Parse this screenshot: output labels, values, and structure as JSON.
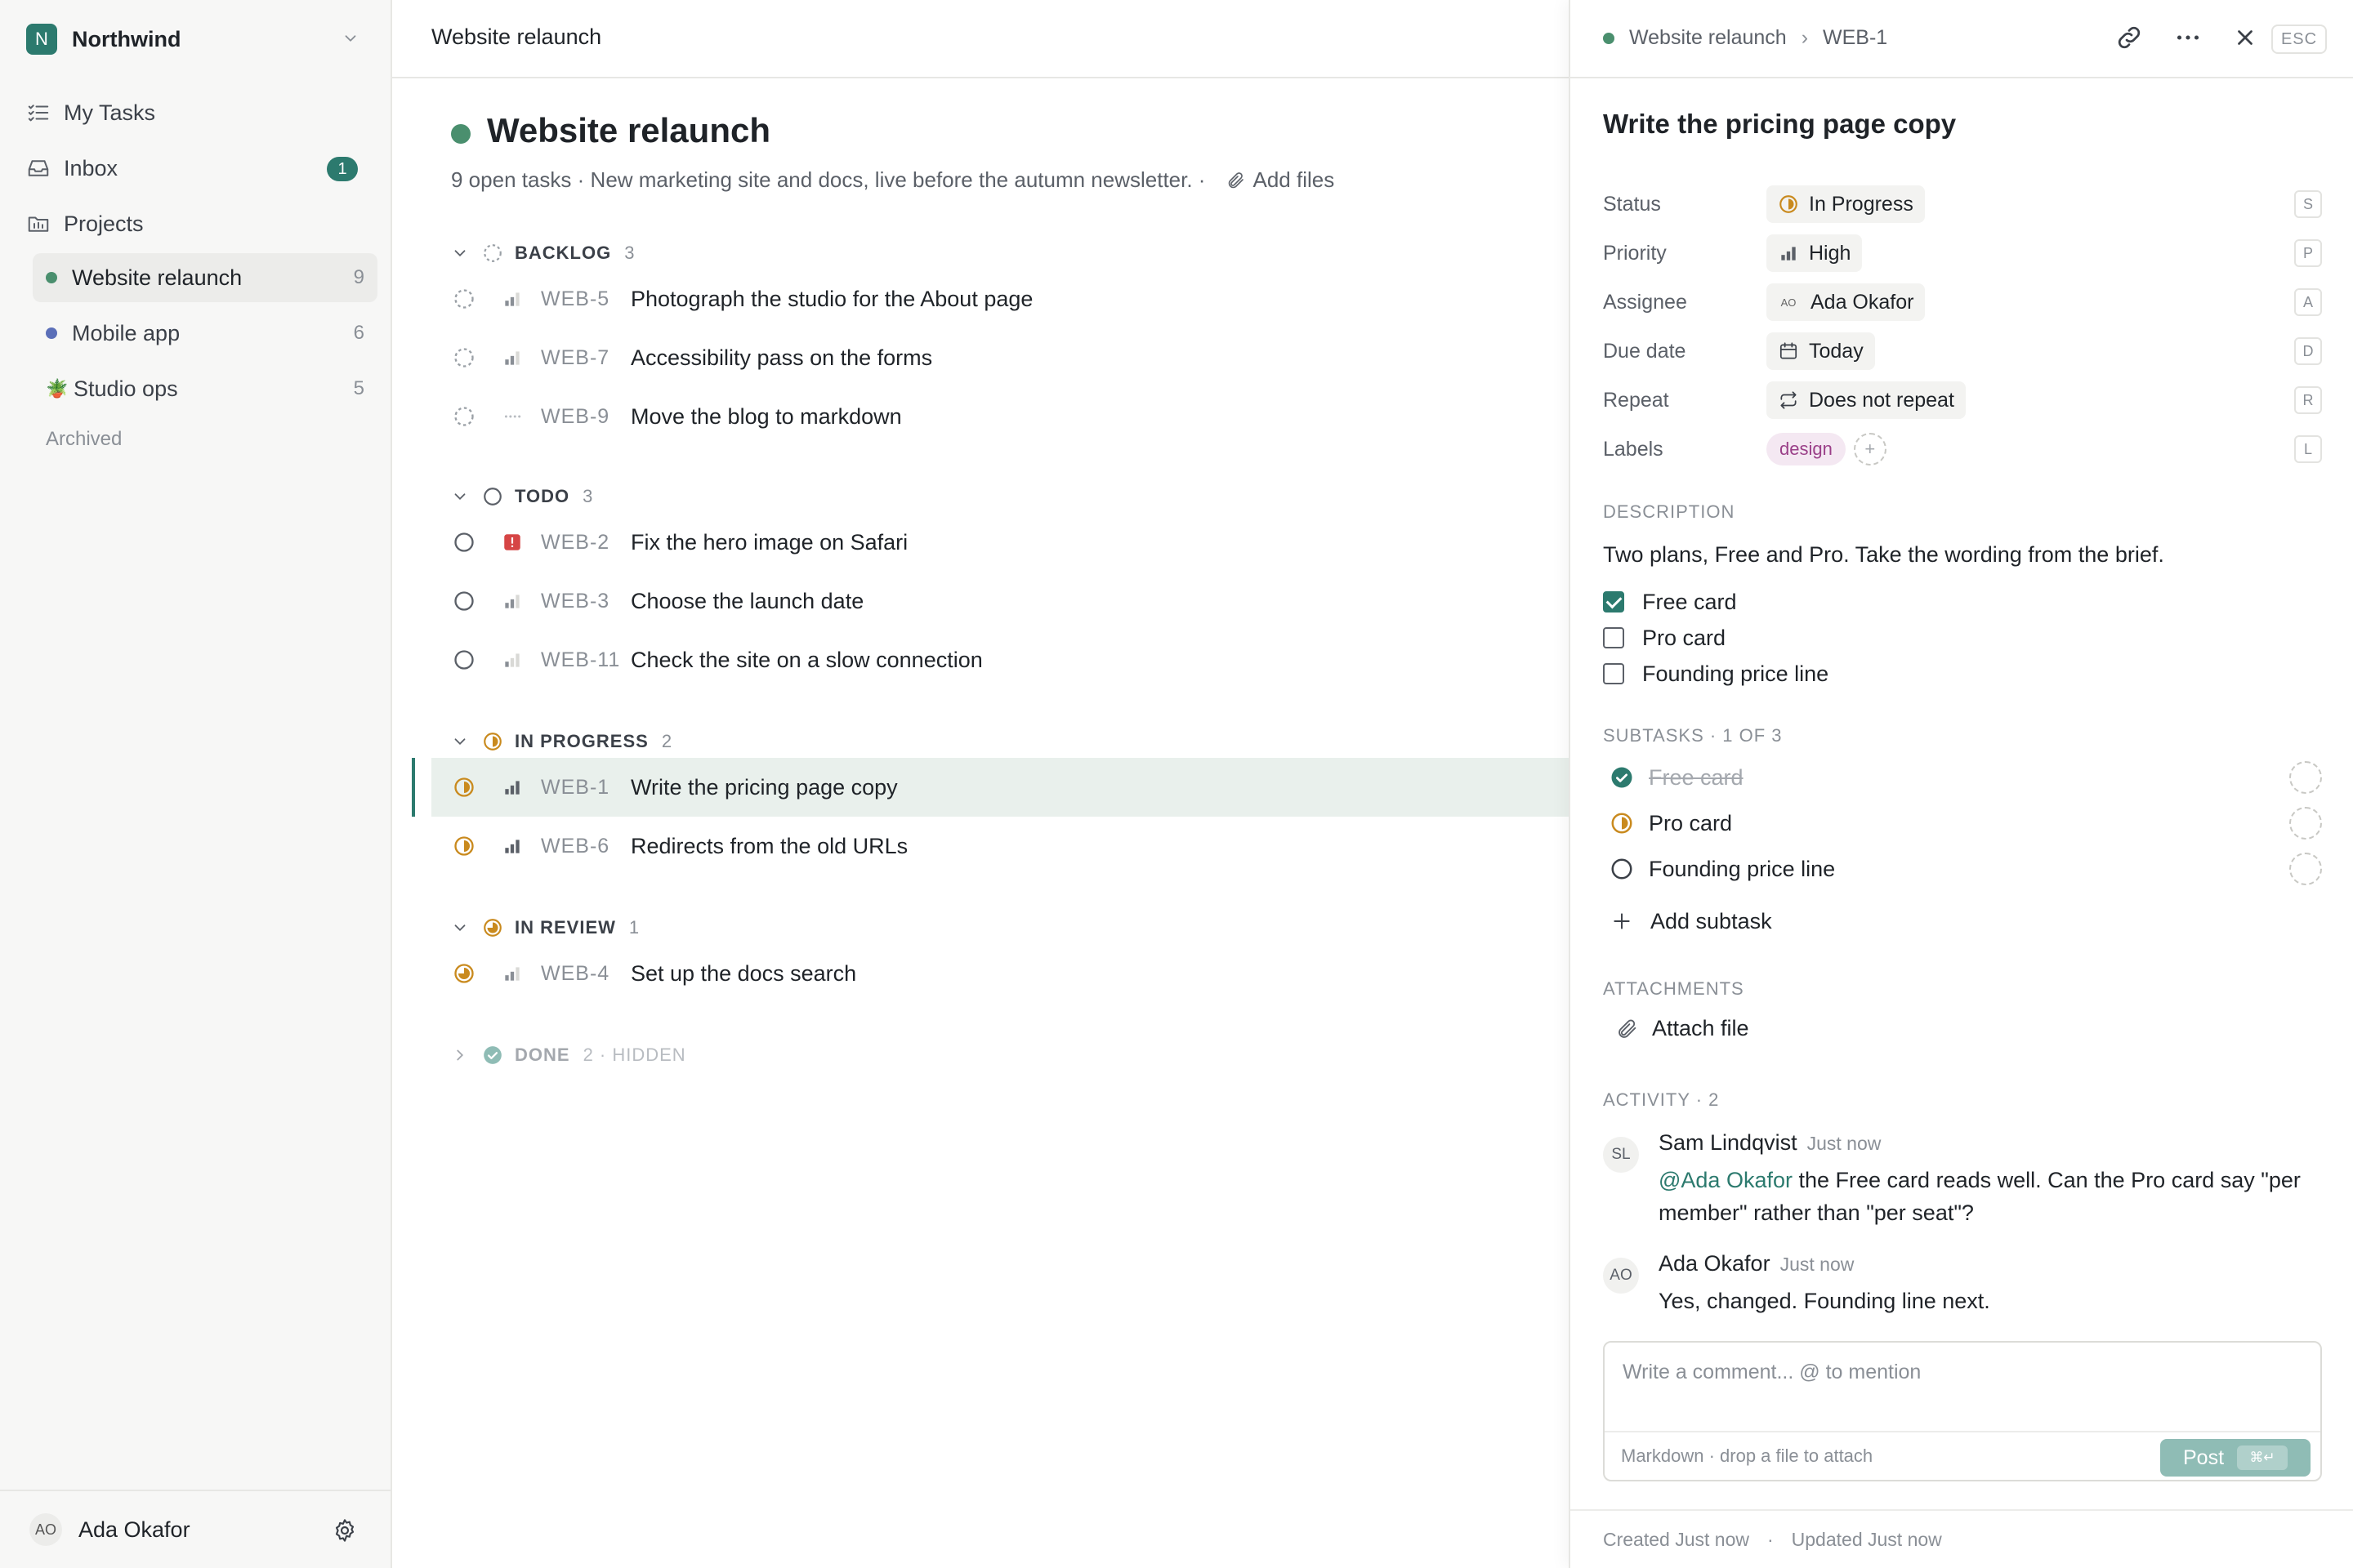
{
  "workspace": {
    "initial": "N",
    "name": "Northwind",
    "color": "#2c7a6e"
  },
  "nav": {
    "my_tasks": "My Tasks",
    "inbox": "Inbox",
    "inbox_count": "1",
    "projects": "Projects"
  },
  "projects": [
    {
      "name": "Website relaunch",
      "count": "9",
      "color": "#4a8f6e",
      "active": true
    },
    {
      "name": "Mobile app",
      "count": "6",
      "color": "#5b6fb8"
    },
    {
      "name": "Studio ops",
      "count": "5",
      "emoji": "🪴"
    }
  ],
  "archived": "Archived",
  "user": {
    "initials": "AO",
    "name": "Ada Okafor"
  },
  "main": {
    "topbar_title": "Website relaunch",
    "title": "Website relaunch",
    "description": "9 open tasks · New marketing site and docs, live before the autumn newsletter.  ·",
    "add_files": "Add files"
  },
  "groups": [
    {
      "name": "BACKLOG",
      "count": "3",
      "status": "backlog",
      "tasks": [
        {
          "id": "WEB-5",
          "title": "Photograph the studio for the About page",
          "priority": "medium"
        },
        {
          "id": "WEB-7",
          "title": "Accessibility pass on the forms",
          "priority": "medium"
        },
        {
          "id": "WEB-9",
          "title": "Move the blog to markdown",
          "priority": "none"
        }
      ]
    },
    {
      "name": "TODO",
      "count": "3",
      "status": "todo",
      "tasks": [
        {
          "id": "WEB-2",
          "title": "Fix the hero image on Safari",
          "priority": "urgent"
        },
        {
          "id": "WEB-3",
          "title": "Choose the launch date",
          "priority": "medium"
        },
        {
          "id": "WEB-11",
          "title": "Check the site on a slow connection",
          "priority": "low"
        }
      ]
    },
    {
      "name": "IN PROGRESS",
      "count": "2",
      "status": "progress",
      "tasks": [
        {
          "id": "WEB-1",
          "title": "Write the pricing page copy",
          "priority": "high",
          "selected": true
        },
        {
          "id": "WEB-6",
          "title": "Redirects from the old URLs",
          "priority": "high"
        }
      ]
    },
    {
      "name": "IN REVIEW",
      "count": "1",
      "status": "review",
      "tasks": [
        {
          "id": "WEB-4",
          "title": "Set up the docs search",
          "priority": "medium"
        }
      ]
    },
    {
      "name": "DONE",
      "count": "2 · HIDDEN",
      "status": "done",
      "collapsed": true,
      "tasks": []
    }
  ],
  "panel": {
    "crumb_project": "Website relaunch",
    "crumb_id": "WEB-1",
    "esc": "ESC",
    "title": "Write the pricing page copy",
    "props": [
      {
        "label": "Status",
        "value": "In Progress",
        "icon": "progress-icon",
        "key": "S"
      },
      {
        "label": "Priority",
        "value": "High",
        "icon": "priority-high-icon",
        "key": "P"
      },
      {
        "label": "Assignee",
        "value": "Ada Okafor",
        "avatar": "AO",
        "key": "A"
      },
      {
        "label": "Due date",
        "value": "Today",
        "icon": "calendar-icon",
        "key": "D"
      },
      {
        "label": "Repeat",
        "value": "Does not repeat",
        "icon": "repeat-icon",
        "key": "R"
      }
    ],
    "labels_label": "Labels",
    "labels": [
      "design"
    ],
    "labels_add": "+",
    "labels_key": "L",
    "description_title": "DESCRIPTION",
    "description_text": "Two plans, Free and Pro. Take the wording from the brief.",
    "checklist": [
      {
        "text": "Free card",
        "checked": true
      },
      {
        "text": "Pro card",
        "checked": false
      },
      {
        "text": "Founding price line",
        "checked": false
      }
    ],
    "subtasks_title": "SUBTASKS · 1 OF 3",
    "subtasks": [
      {
        "text": "Free card",
        "status": "done"
      },
      {
        "text": "Pro card",
        "status": "progress"
      },
      {
        "text": "Founding price line",
        "status": "todo"
      }
    ],
    "add_subtask": "Add subtask",
    "attachments_title": "ATTACHMENTS",
    "attach_file": "Attach file",
    "activity_title": "ACTIVITY · 2",
    "comments": [
      {
        "initials": "SL",
        "author": "Sam Lindqvist",
        "time": "Just now",
        "mention": "@Ada Okafor",
        "text": " the Free card reads well. Can the Pro card say \"per member\" rather than \"per seat\"?"
      },
      {
        "initials": "AO",
        "author": "Ada Okafor",
        "time": "Just now",
        "mention": "",
        "text": "Yes, changed. Founding line next."
      }
    ],
    "composer_placeholder": "Write a comment... @ to mention",
    "composer_hint": "Markdown · drop a file to attach",
    "post_label": "Post",
    "post_kbd": "⌘↵",
    "created": "Created Just now",
    "updated": "Updated Just now"
  },
  "colors": {
    "accent": "#2c7a6e",
    "progress": "#c98a1e",
    "urgent": "#d64545",
    "label_bg": "#f4e8f2",
    "label_fg": "#9a3f88"
  }
}
